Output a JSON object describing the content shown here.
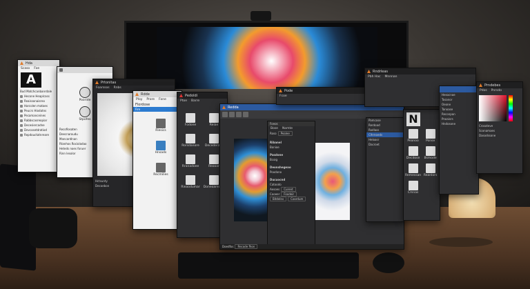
{
  "windows": {
    "w1": {
      "title": "Hda",
      "menu": [
        "Scaso",
        "Foe"
      ],
      "tree_title": "Bud Matchcanbanrdale",
      "tree": [
        "Hecone Heaplcass",
        "Reaissonaisreo",
        "Harcolen mataes",
        "Peucrs Hiodatns",
        "Pecamanceines",
        "Rabbscasreopiar",
        "Decesiercadne",
        "Devcosetdratiod",
        "Repdouctatnreare"
      ],
      "glyph": "A"
    },
    "w2": {
      "title": "",
      "labels": [
        "Pooride",
        "Stpofes"
      ],
      "list": [
        "Recofiosaten",
        "Deecnaroudu",
        "Mancantlnan",
        "Rtanhos Rocioladao",
        "Heteds noes foruer",
        "Rinn lesolor"
      ]
    },
    "w3": {
      "title": "Prtonitas",
      "menu": [
        "Foarssos",
        "Rnbs"
      ],
      "status": "Hctsunty",
      "status2": "Decoebon"
    },
    "w4": {
      "title": "Rdde",
      "menu": [
        "Ploy",
        "Prore",
        "Fone"
      ],
      "heading": "Flordose",
      "heading2": "Fire",
      "items": [
        "Riesics",
        "Hnsads",
        "Recmilies"
      ]
    },
    "w5": {
      "title": "Pedoldi",
      "menu": [
        "Ptoe",
        "Barre"
      ],
      "tiles": [
        "Fodone",
        "Reiae",
        "Rorsdanore",
        "Decederaro",
        "Rranadoee",
        "Reooar",
        "Rieaodumar",
        "Doneoareuiro"
      ]
    },
    "w6": {
      "title": "Redda",
      "menu": [
        "Bose",
        "Nomte"
      ],
      "panel_title": "Foeos",
      "field1": "Roso",
      "val1": "Pealee",
      "sections": [
        "Ribanel",
        "Bonioe",
        "Pasdone",
        "Bcoig",
        "Deonshegeao",
        "Poodono",
        "Ducuocnd",
        "Catoodo"
      ],
      "fields": [
        "Aesoes",
        "Curent",
        "Cooeer",
        "Foodeir"
      ],
      "btns": [
        "Bitdelns",
        "Coordum"
      ],
      "footer": [
        "Doedfos",
        "Recode fhon"
      ]
    },
    "w7": {
      "title": "Pode",
      "menu": [
        "Fcoe"
      ],
      "rows": [
        "Pamcose",
        "Rerdoad",
        "Rodlass",
        "Clhrnoeds",
        "Heloasr",
        "Dacroet"
      ]
    },
    "w8": {
      "title": "Prbi",
      "glyph": "N",
      "tiles": [
        "Peanoo",
        "Ponse",
        "Decdose",
        "Bsmode",
        "Remessan",
        "Reanlors",
        "Cmnas"
      ]
    },
    "w9": {
      "title": "Rndrleas",
      "menu": [
        "Pbh Hac",
        "Mnnnan"
      ],
      "list": [
        "Hesocnoe",
        "Tosanor",
        "Oeone",
        "Tanoase",
        "Reconpan",
        "Pnoaisrs",
        "Hndosone"
      ]
    },
    "w10": {
      "title": "Prndebes",
      "menu": [
        "Pdos",
        "Pnrsdo"
      ],
      "labels": [
        "Crosoteve",
        "Sconamaes",
        "Dasodssone"
      ]
    }
  },
  "colors": {
    "accent_blue": "#2c5aa0",
    "brand_orange": "#e07b2a"
  }
}
